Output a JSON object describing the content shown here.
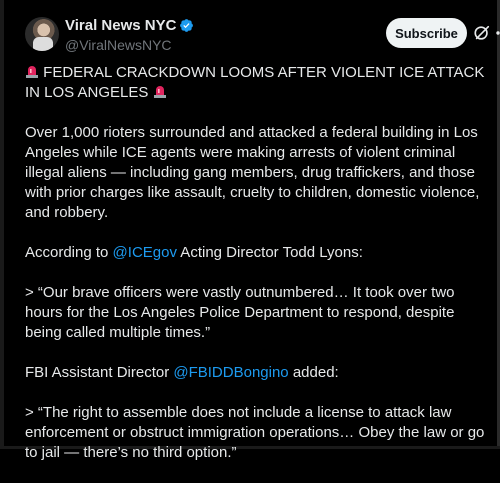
{
  "author": {
    "display_name": "Viral News NYC",
    "handle": "@ViralNewsNYC"
  },
  "actions": {
    "subscribe_label": "Subscribe"
  },
  "icons": {
    "verified": "verified-badge-icon",
    "grok": "grok-icon",
    "more": "more-options-icon",
    "siren": "police-light-emoji"
  },
  "colors": {
    "background": "#000000",
    "text": "#e7e9ea",
    "muted": "#71767b",
    "link": "#1d9bf0",
    "verified": "#1d9bf0",
    "siren": "#e0245e"
  },
  "post": {
    "headline": "FEDERAL CRACKDOWN LOOMS AFTER VIOLENT ICE ATTACK IN LOS ANGELES",
    "paragraph1": "Over 1,000 rioters surrounded and attacked a federal building in Los Angeles while ICE agents were making arrests of violent criminal illegal aliens — including gang members, drug traffickers, and those with prior charges like assault, cruelty to children, domestic violence, and robbery.",
    "p2_prefix": "According to ",
    "p2_mention": "@ICEgov",
    "p2_suffix": " Acting Director Todd Lyons:",
    "quote1": "> “Our brave officers were vastly outnumbered… It took over two hours for the Los Angeles Police Department to respond, despite being called multiple times.”",
    "p4_prefix": "FBI Assistant Director ",
    "p4_mention": "@FBIDDBongino",
    "p4_suffix": " added:",
    "quote2": "> “The right to assemble does not include a license to attack law enforcement or obstruct immigration operations… Obey the law or go to jail — there’s no third option.”"
  }
}
